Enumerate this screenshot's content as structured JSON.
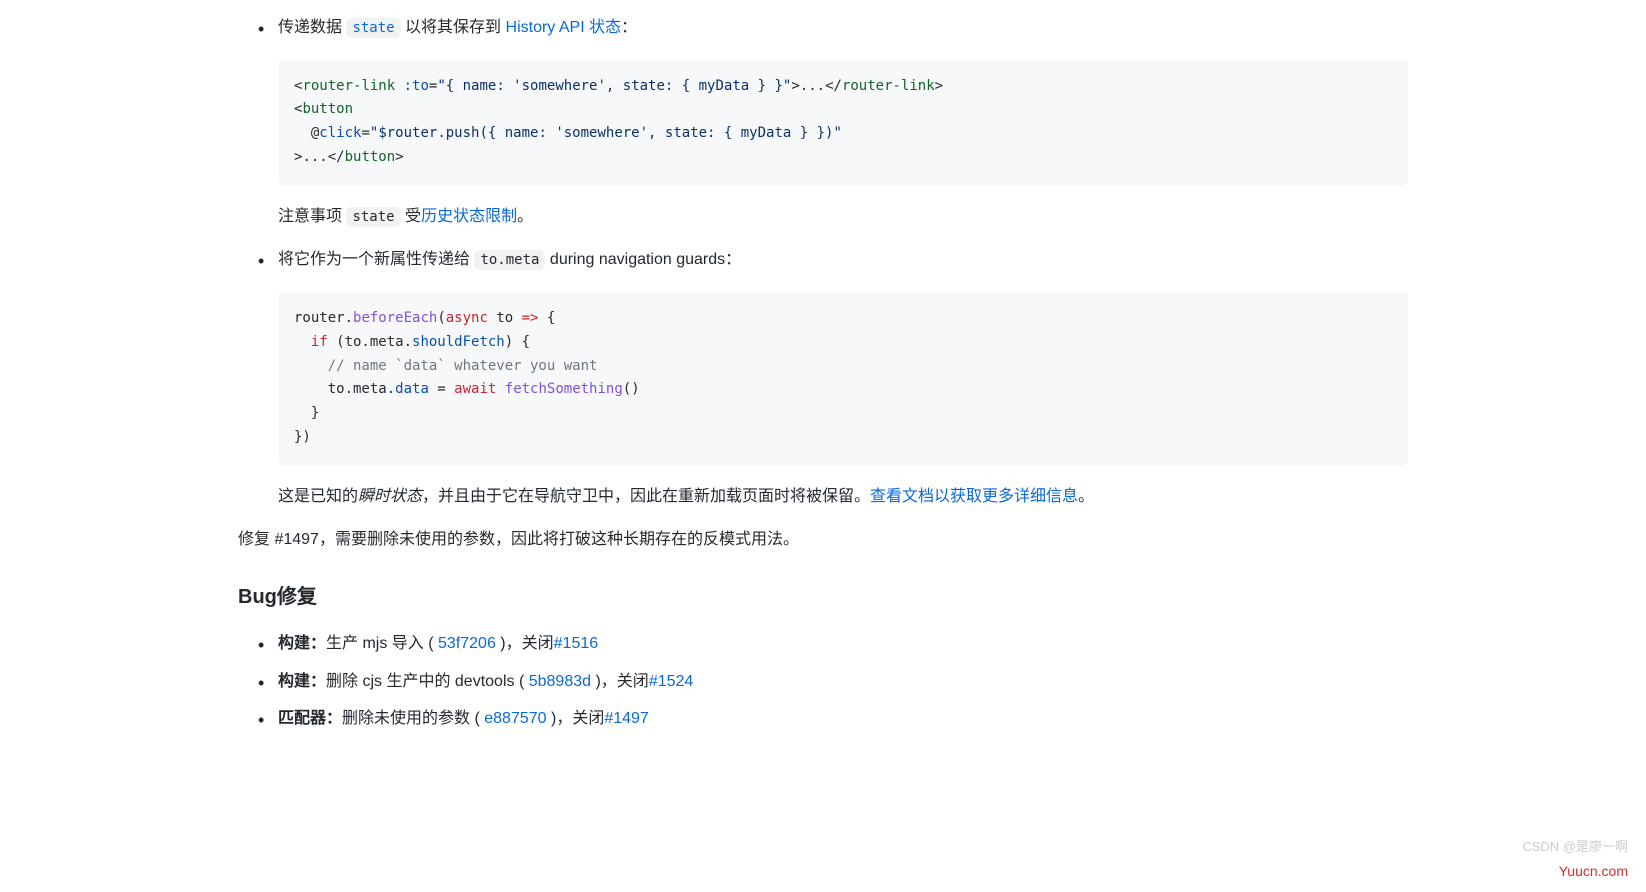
{
  "bullet1": {
    "pre": "传递数据 ",
    "code": "state",
    "mid": " 以将其保存到 ",
    "link": "History API 状态",
    "post": "："
  },
  "codeblock1": {
    "line1_open": "<",
    "line1_tag": "router-link",
    "line1_sp": " ",
    "line1_attr": ":to",
    "line1_eq": "=",
    "line1_val": "\"{ name: 'somewhere', state: { myData } }\"",
    "line1_gt": ">",
    "line1_text": "...",
    "line1_close_lt": "</",
    "line1_close_tag": "router-link",
    "line1_close_gt": ">",
    "line2_open": "<",
    "line2_tag": "button",
    "line3_ind": "  @",
    "line3_attr": "click",
    "line3_eq": "=",
    "line3_val": "\"$router.push({ name: 'somewhere', state: { myData } })\"",
    "line4_gt": ">",
    "line4_text": "...",
    "line4_close_lt": "</",
    "line4_close_tag": "button",
    "line4_close_gt": ">"
  },
  "note": {
    "pre": "注意事项 ",
    "code": "state",
    "mid": " 受",
    "link": "历史状态限制",
    "post": "。"
  },
  "bullet2": {
    "pre": "将它作为一个新属性传递给 ",
    "code": "to.meta",
    "post": " during navigation guards："
  },
  "codeblock2": {
    "l1_a": "router.",
    "l1_b": "beforeEach",
    "l1_c": "(",
    "l1_d": "async",
    "l1_e": " to ",
    "l1_f": "=>",
    "l1_g": " {",
    "l2_a": "  ",
    "l2_b": "if",
    "l2_c": " (to.meta.",
    "l2_d": "shouldFetch",
    "l2_e": ") {",
    "l3": "    // name `data` whatever you want",
    "l4_a": "    to.meta.",
    "l4_b": "data",
    "l4_c": " = ",
    "l4_d": "await",
    "l4_e": " ",
    "l4_f": "fetchSomething",
    "l4_g": "()",
    "l5": "  }",
    "l6": "})"
  },
  "para2": {
    "pre": "这是已知的",
    "italic": "瞬时状态",
    "mid": "，并且由于它在导航守卫中，因此在重新加载页面时将被保留。",
    "link": "查看文档以获取更多详细信息",
    "post": "。"
  },
  "para3": "修复 #1497，需要删除未使用的参数，因此将打破这种长期存在的反模式用法。",
  "h3": "Bug修复",
  "bugs": {
    "0": {
      "label": "构建：",
      "desc": "生产 mjs 导入 ( ",
      "hash": "53f7206",
      "mid": " )，关闭",
      "issue": "#1516"
    },
    "1": {
      "label": "构建：",
      "desc": "删除 cjs 生产中的 devtools ( ",
      "hash": "5b8983d",
      "mid": " )，关闭",
      "issue": "#1524"
    },
    "2": {
      "label": "匹配器：",
      "desc": "删除未使用的参数 ( ",
      "hash": "e887570",
      "mid": " )，关闭",
      "issue": "#1497"
    }
  },
  "watermark_site": "Yuucn.com",
  "watermark_csdn": "CSDN @是廖一啊"
}
